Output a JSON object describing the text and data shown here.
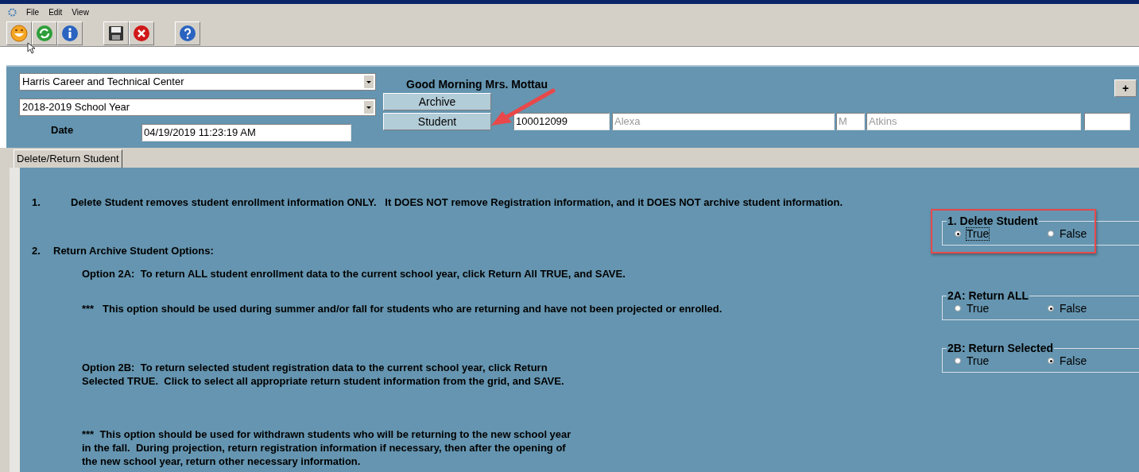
{
  "menu": [
    {
      "label": "File"
    },
    {
      "label": "Edit"
    },
    {
      "label": "View"
    }
  ],
  "header": {
    "school": "Harris Career and Technical Center",
    "school_year": "2018-2019 School Year",
    "greeting": "Good Morning Mrs. Mottau",
    "archive_button": "Archive",
    "date_label": "Date",
    "date": "04/19/2019 11:23:19 AM",
    "student_button": "Student",
    "student_id": "100012099",
    "first_name": "Alexa",
    "middle_initial": "M",
    "last_name": "Atkins",
    "plus_button": "+"
  },
  "tabs": [
    {
      "label": "Delete/Return Student",
      "selected": true
    }
  ],
  "content": {
    "item_1": {
      "number": "1.",
      "text": "Delete Student removes student enrollment information ONLY.   It DOES NOT remove Registration information, and it DOES NOT archive student information."
    },
    "item_2": {
      "number": "2.",
      "text": "Return Archive Student Options:"
    },
    "option_2a": "Option 2A:  To return ALL student enrollment data to the current school year, click Return All TRUE, and SAVE.",
    "note_2a": "***   This option should be used during summer and/or fall for students who are returning and have not been projected or enrolled.",
    "option_2b": [
      "Option 2B:  To return selected student registration data to the current school year, click Return",
      "Selected TRUE.  Click to select all appropriate return student information from the grid, and SAVE."
    ],
    "note_2b": [
      "***  This option should be used for withdrawn students who will be returning to the new school year",
      "in the fall.  During projection, return registration information if necessary, then after the opening of",
      "the new school year, return other necessary information."
    ]
  },
  "radio_groups": [
    {
      "title": "1.  Delete Student",
      "highlighted": true,
      "options": [
        {
          "label": "True",
          "selected": true,
          "focused": true
        },
        {
          "label": "False",
          "selected": false,
          "focused": false
        }
      ]
    },
    {
      "title": "2A: Return ALL",
      "highlighted": false,
      "options": [
        {
          "label": "True",
          "selected": false,
          "focused": false
        },
        {
          "label": "False",
          "selected": true,
          "focused": false
        }
      ]
    },
    {
      "title": "2B: Return Selected",
      "highlighted": false,
      "options": [
        {
          "label": "True",
          "selected": false,
          "focused": false
        },
        {
          "label": "False",
          "selected": true,
          "focused": false
        }
      ]
    }
  ]
}
